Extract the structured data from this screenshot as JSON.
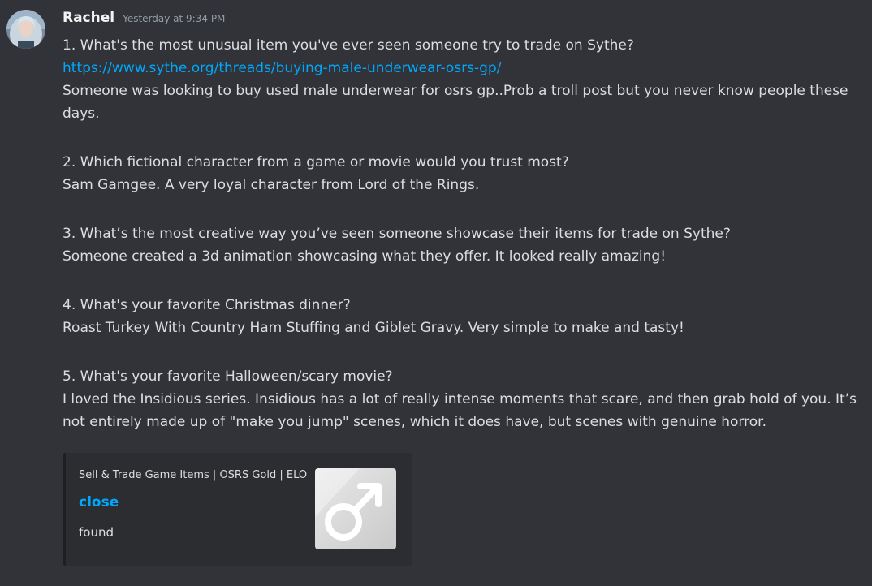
{
  "message": {
    "author": "Rachel",
    "timestamp": "Yesterday at 9:34 PM",
    "avatar_icon": "user-avatar",
    "lines": {
      "q1": "1. What's the most unusual item you've ever seen someone try to trade on Sythe?",
      "q1_link": "https://www.sythe.org/threads/buying-male-underwear-osrs-gp/",
      "a1": "Someone was looking to buy used male underwear for osrs gp..Prob a troll post but you never know people these days.",
      "q2": "2. Which fictional character from a game or movie would you trust most?",
      "a2": "Sam Gamgee. A very loyal character from Lord of the Rings.",
      "q3": "3. What’s the most creative way you’ve seen someone showcase their items for trade on Sythe?",
      "a3": "Someone created a 3d animation showcasing what they offer. It looked really amazing!",
      "q4": "4. What's your favorite Christmas dinner?",
      "a4": "Roast Turkey With Country Ham Stuffing and Giblet Gravy. Very simple to make and tasty!",
      "q5": "5. What's your favorite Halloween/scary movie?",
      "a5": "I loved the Insidious series. Insidious has a lot of really intense moments that scare, and then grab hold of you. It’s not entirely made up of \"make you jump\" scenes, which it does have, but scenes with genuine horror."
    }
  },
  "embed": {
    "provider": "Sell & Trade Game Items | OSRS Gold | ELO",
    "title": "close",
    "description": "found",
    "thumbnail_icon": "male-symbol-icon"
  },
  "colors": {
    "background": "#313338",
    "link": "#00a8fc",
    "text": "#dbdee1",
    "embed_background": "#2b2d31"
  }
}
